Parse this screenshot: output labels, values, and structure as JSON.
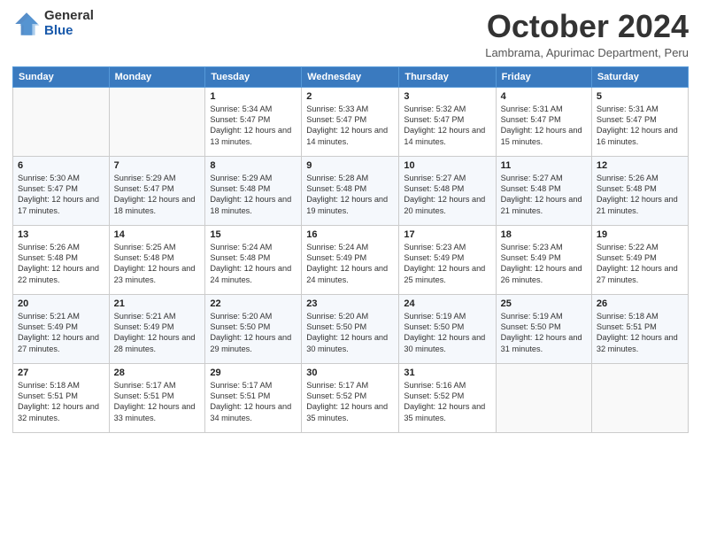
{
  "logo": {
    "general": "General",
    "blue": "Blue"
  },
  "title": "October 2024",
  "location": "Lambrama, Apurimac Department, Peru",
  "days_of_week": [
    "Sunday",
    "Monday",
    "Tuesday",
    "Wednesday",
    "Thursday",
    "Friday",
    "Saturday"
  ],
  "weeks": [
    [
      {
        "day": "",
        "info": ""
      },
      {
        "day": "",
        "info": ""
      },
      {
        "day": "1",
        "info": "Sunrise: 5:34 AM\nSunset: 5:47 PM\nDaylight: 12 hours and 13 minutes."
      },
      {
        "day": "2",
        "info": "Sunrise: 5:33 AM\nSunset: 5:47 PM\nDaylight: 12 hours and 14 minutes."
      },
      {
        "day": "3",
        "info": "Sunrise: 5:32 AM\nSunset: 5:47 PM\nDaylight: 12 hours and 14 minutes."
      },
      {
        "day": "4",
        "info": "Sunrise: 5:31 AM\nSunset: 5:47 PM\nDaylight: 12 hours and 15 minutes."
      },
      {
        "day": "5",
        "info": "Sunrise: 5:31 AM\nSunset: 5:47 PM\nDaylight: 12 hours and 16 minutes."
      }
    ],
    [
      {
        "day": "6",
        "info": "Sunrise: 5:30 AM\nSunset: 5:47 PM\nDaylight: 12 hours and 17 minutes."
      },
      {
        "day": "7",
        "info": "Sunrise: 5:29 AM\nSunset: 5:47 PM\nDaylight: 12 hours and 18 minutes."
      },
      {
        "day": "8",
        "info": "Sunrise: 5:29 AM\nSunset: 5:48 PM\nDaylight: 12 hours and 18 minutes."
      },
      {
        "day": "9",
        "info": "Sunrise: 5:28 AM\nSunset: 5:48 PM\nDaylight: 12 hours and 19 minutes."
      },
      {
        "day": "10",
        "info": "Sunrise: 5:27 AM\nSunset: 5:48 PM\nDaylight: 12 hours and 20 minutes."
      },
      {
        "day": "11",
        "info": "Sunrise: 5:27 AM\nSunset: 5:48 PM\nDaylight: 12 hours and 21 minutes."
      },
      {
        "day": "12",
        "info": "Sunrise: 5:26 AM\nSunset: 5:48 PM\nDaylight: 12 hours and 21 minutes."
      }
    ],
    [
      {
        "day": "13",
        "info": "Sunrise: 5:26 AM\nSunset: 5:48 PM\nDaylight: 12 hours and 22 minutes."
      },
      {
        "day": "14",
        "info": "Sunrise: 5:25 AM\nSunset: 5:48 PM\nDaylight: 12 hours and 23 minutes."
      },
      {
        "day": "15",
        "info": "Sunrise: 5:24 AM\nSunset: 5:48 PM\nDaylight: 12 hours and 24 minutes."
      },
      {
        "day": "16",
        "info": "Sunrise: 5:24 AM\nSunset: 5:49 PM\nDaylight: 12 hours and 24 minutes."
      },
      {
        "day": "17",
        "info": "Sunrise: 5:23 AM\nSunset: 5:49 PM\nDaylight: 12 hours and 25 minutes."
      },
      {
        "day": "18",
        "info": "Sunrise: 5:23 AM\nSunset: 5:49 PM\nDaylight: 12 hours and 26 minutes."
      },
      {
        "day": "19",
        "info": "Sunrise: 5:22 AM\nSunset: 5:49 PM\nDaylight: 12 hours and 27 minutes."
      }
    ],
    [
      {
        "day": "20",
        "info": "Sunrise: 5:21 AM\nSunset: 5:49 PM\nDaylight: 12 hours and 27 minutes."
      },
      {
        "day": "21",
        "info": "Sunrise: 5:21 AM\nSunset: 5:49 PM\nDaylight: 12 hours and 28 minutes."
      },
      {
        "day": "22",
        "info": "Sunrise: 5:20 AM\nSunset: 5:50 PM\nDaylight: 12 hours and 29 minutes."
      },
      {
        "day": "23",
        "info": "Sunrise: 5:20 AM\nSunset: 5:50 PM\nDaylight: 12 hours and 30 minutes."
      },
      {
        "day": "24",
        "info": "Sunrise: 5:19 AM\nSunset: 5:50 PM\nDaylight: 12 hours and 30 minutes."
      },
      {
        "day": "25",
        "info": "Sunrise: 5:19 AM\nSunset: 5:50 PM\nDaylight: 12 hours and 31 minutes."
      },
      {
        "day": "26",
        "info": "Sunrise: 5:18 AM\nSunset: 5:51 PM\nDaylight: 12 hours and 32 minutes."
      }
    ],
    [
      {
        "day": "27",
        "info": "Sunrise: 5:18 AM\nSunset: 5:51 PM\nDaylight: 12 hours and 32 minutes."
      },
      {
        "day": "28",
        "info": "Sunrise: 5:17 AM\nSunset: 5:51 PM\nDaylight: 12 hours and 33 minutes."
      },
      {
        "day": "29",
        "info": "Sunrise: 5:17 AM\nSunset: 5:51 PM\nDaylight: 12 hours and 34 minutes."
      },
      {
        "day": "30",
        "info": "Sunrise: 5:17 AM\nSunset: 5:52 PM\nDaylight: 12 hours and 35 minutes."
      },
      {
        "day": "31",
        "info": "Sunrise: 5:16 AM\nSunset: 5:52 PM\nDaylight: 12 hours and 35 minutes."
      },
      {
        "day": "",
        "info": ""
      },
      {
        "day": "",
        "info": ""
      }
    ]
  ]
}
